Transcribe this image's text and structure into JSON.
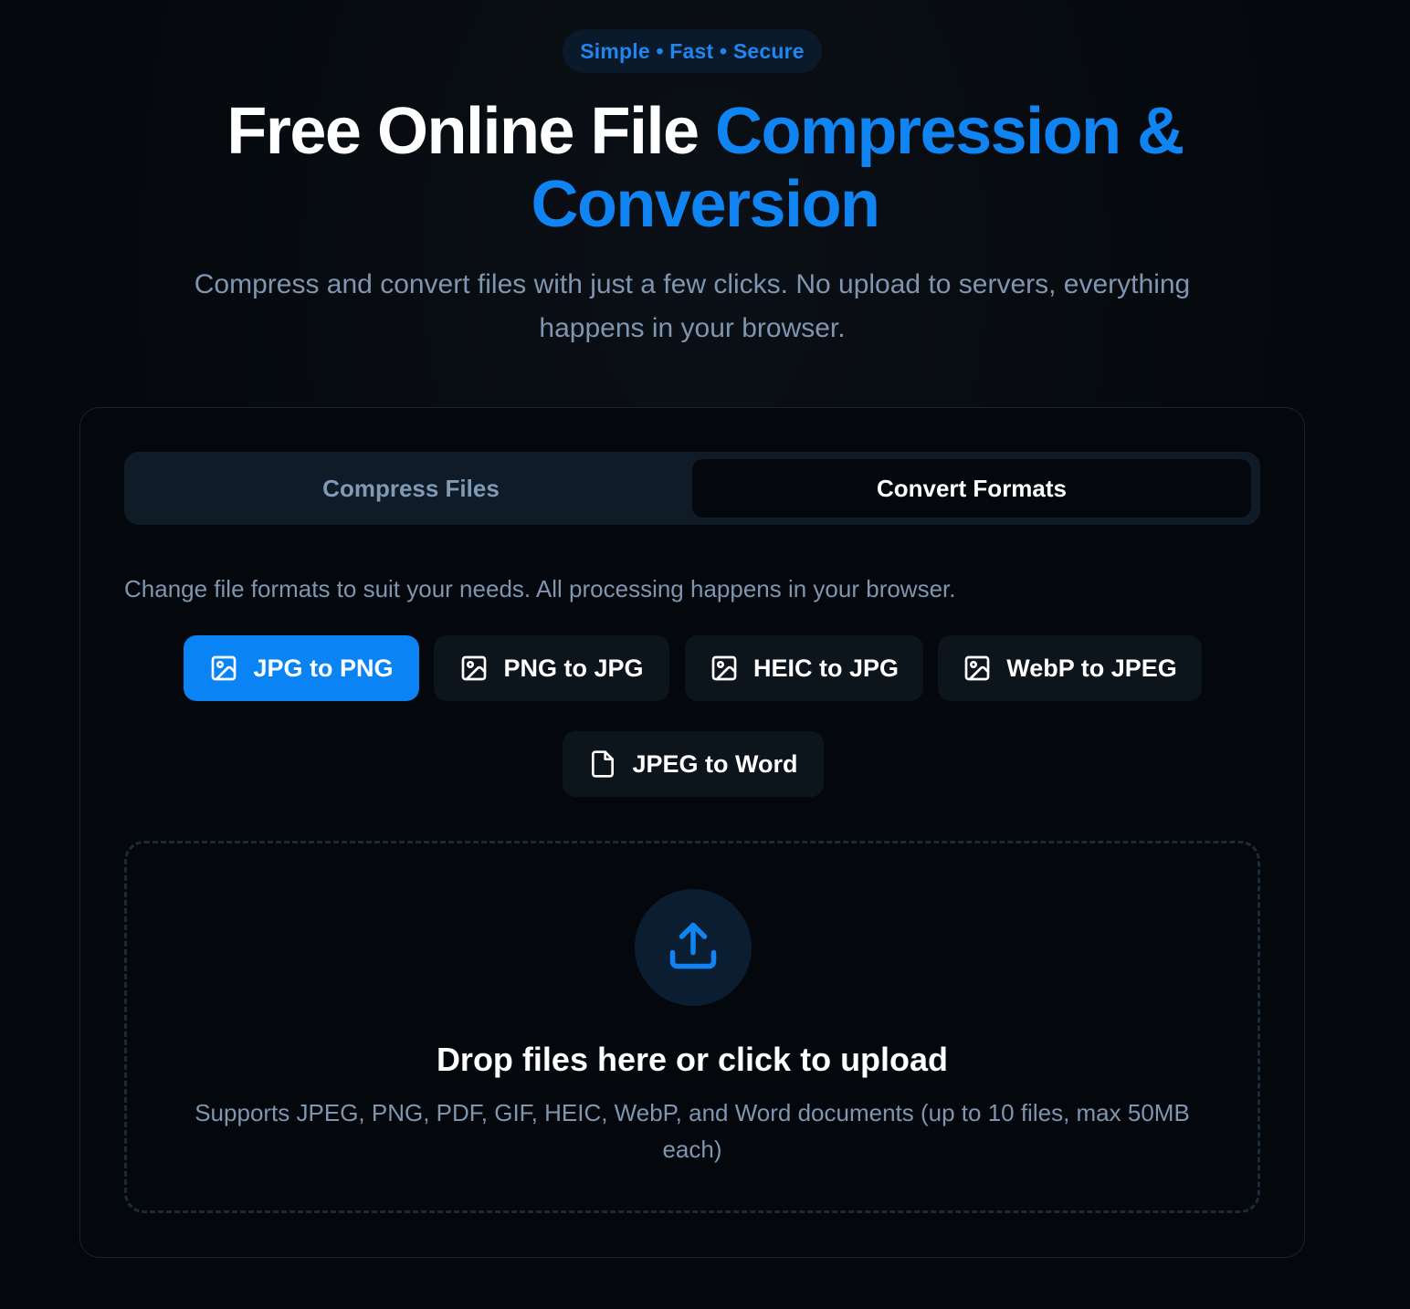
{
  "badge": {
    "text": "Simple • Fast • Secure"
  },
  "hero": {
    "title_white": "Free Online File",
    "title_blue_line1": "Compression &",
    "title_blue_line2": "Conversion",
    "subtitle": "Compress and convert files with just a few clicks. No upload to servers, everything happens in your browser."
  },
  "tabs": [
    {
      "label": "Compress Files",
      "active": false
    },
    {
      "label": "Convert Formats",
      "active": true
    }
  ],
  "convert": {
    "description": "Change file formats to suit your needs. All processing happens in your browser.",
    "formats": [
      {
        "label": "JPG to PNG",
        "icon": "image-icon",
        "active": true
      },
      {
        "label": "PNG to JPG",
        "icon": "image-icon",
        "active": false
      },
      {
        "label": "HEIC to JPG",
        "icon": "image-icon",
        "active": false
      },
      {
        "label": "WebP to JPEG",
        "icon": "image-icon",
        "active": false
      },
      {
        "label": "JPEG to Word",
        "icon": "file-icon",
        "active": false
      }
    ]
  },
  "dropzone": {
    "icon": "upload-icon",
    "title": "Drop files here or click to upload",
    "subtitle": "Supports JPEG, PNG, PDF, GIF, HEIC, WebP, and Word documents (up to 10 files, max 50MB each)"
  },
  "colors": {
    "accent": "#0a84f5",
    "background": "#04080c",
    "muted_text": "#7f95b0"
  }
}
